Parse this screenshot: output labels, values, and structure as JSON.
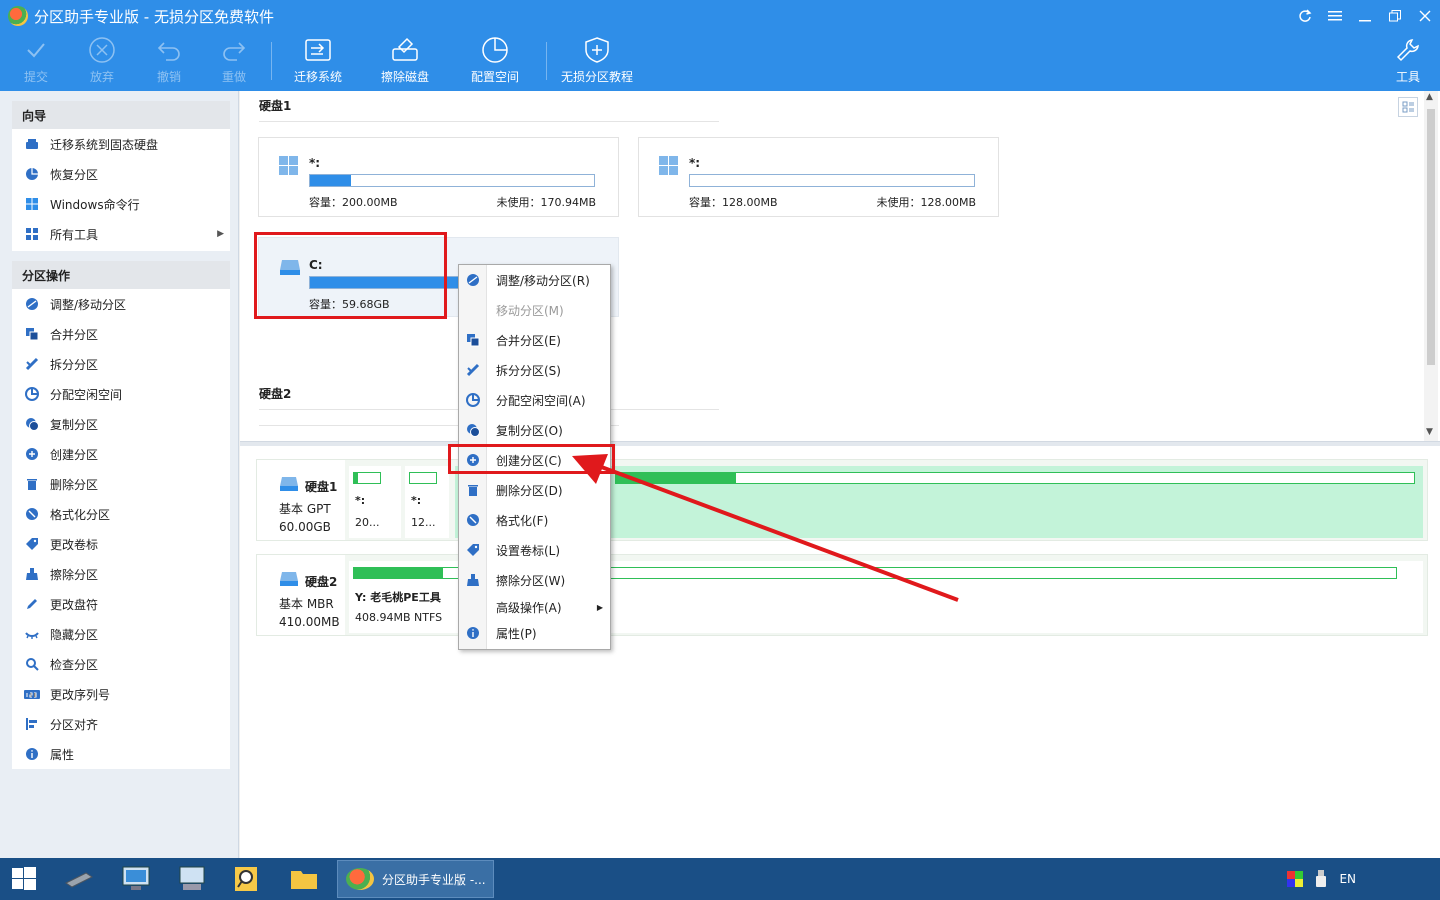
{
  "window": {
    "title": "分区助手专业版 - 无损分区免费软件"
  },
  "toolbar": {
    "commit": "提交",
    "discard": "放弃",
    "undo": "撤销",
    "redo": "重做",
    "migrate": "迁移系统",
    "wipe_disk": "擦除磁盘",
    "allocate": "配置空间",
    "tutorial": "无损分区教程",
    "tools": "工具"
  },
  "sidebar": {
    "wizard_title": "向导",
    "wizard_items": [
      {
        "label": "迁移系统到固态硬盘",
        "icon": "migrate-ssd-icon"
      },
      {
        "label": "恢复分区",
        "icon": "recover-partition-icon"
      },
      {
        "label": "Windows命令行",
        "icon": "windows-icon"
      },
      {
        "label": "所有工具",
        "icon": "all-tools-icon"
      }
    ],
    "ops_title": "分区操作",
    "ops_items": [
      {
        "label": "调整/移动分区",
        "icon": "resize-partition-icon"
      },
      {
        "label": "合并分区",
        "icon": "merge-partition-icon"
      },
      {
        "label": "拆分分区",
        "icon": "split-partition-icon"
      },
      {
        "label": "分配空闲空间",
        "icon": "allocate-space-icon"
      },
      {
        "label": "复制分区",
        "icon": "copy-partition-icon"
      },
      {
        "label": "创建分区",
        "icon": "create-partition-icon"
      },
      {
        "label": "删除分区",
        "icon": "delete-partition-icon"
      },
      {
        "label": "格式化分区",
        "icon": "format-partition-icon"
      },
      {
        "label": "更改卷标",
        "icon": "label-icon"
      },
      {
        "label": "擦除分区",
        "icon": "wipe-partition-icon"
      },
      {
        "label": "更改盘符",
        "icon": "change-letter-icon"
      },
      {
        "label": "隐藏分区",
        "icon": "hide-partition-icon"
      },
      {
        "label": "检查分区",
        "icon": "check-partition-icon"
      },
      {
        "label": "更改序列号",
        "icon": "serial-number-icon"
      },
      {
        "label": "分区对齐",
        "icon": "align-partition-icon"
      },
      {
        "label": "属性",
        "icon": "info-icon"
      }
    ]
  },
  "disk1": {
    "title": "硬盘1",
    "part1": {
      "name": "*:",
      "capacity": "容量：200.00MB",
      "unused": "未使用：170.94MB",
      "used_fraction": 0.145
    },
    "part2": {
      "name": "*:",
      "capacity": "容量：128.00MB",
      "unused": "未使用：128.00MB",
      "used_fraction": 0.0
    },
    "part3": {
      "name": "C:",
      "capacity": "容量：59.68GB",
      "used_fraction": 0.6
    }
  },
  "disk2": {
    "title": "硬盘2"
  },
  "map": {
    "disk1": {
      "name": "硬盘1",
      "type": "基本 GPT",
      "size": "60.00GB",
      "p1_label": "*:",
      "p1_value": "20...",
      "p2_label": "*:",
      "p2_value": "12..."
    },
    "disk2": {
      "name": "硬盘2",
      "type": "基本 MBR",
      "size": "410.00MB",
      "p1_label": "Y: 老毛桃PE工具",
      "p1_value": "408.94MB NTFS"
    }
  },
  "context_menu": {
    "items": [
      {
        "label": "调整/移动分区(R)",
        "icon": "resize-partition-icon",
        "enabled": true
      },
      {
        "label": "移动分区(M)",
        "icon": "",
        "enabled": false
      },
      {
        "label": "合并分区(E)",
        "icon": "merge-partition-icon",
        "enabled": true
      },
      {
        "label": "拆分分区(S)",
        "icon": "split-partition-icon",
        "enabled": true
      },
      {
        "label": "分配空闲空间(A)",
        "icon": "allocate-space-icon",
        "enabled": true
      },
      {
        "label": "复制分区(O)",
        "icon": "copy-partition-icon",
        "enabled": true
      },
      {
        "label": "创建分区(C)",
        "icon": "create-partition-icon",
        "enabled": true
      },
      {
        "label": "删除分区(D)",
        "icon": "delete-partition-icon",
        "enabled": true
      },
      {
        "label": "格式化(F)",
        "icon": "format-partition-icon",
        "enabled": true
      },
      {
        "label": "设置卷标(L)",
        "icon": "label-icon",
        "enabled": true
      },
      {
        "label": "擦除分区(W)",
        "icon": "wipe-partition-icon",
        "enabled": true
      },
      {
        "label": "高级操作(A)",
        "icon": "",
        "enabled": true,
        "submenu": true
      },
      {
        "label": "属性(P)",
        "icon": "info-icon",
        "enabled": true
      }
    ]
  },
  "taskbar": {
    "active_window": "分区助手专业版 -...",
    "lang": "EN"
  },
  "colors": {
    "accent": "#2f8ee8",
    "highlight_red": "#e0191c",
    "partition_green": "#2fbf57"
  }
}
